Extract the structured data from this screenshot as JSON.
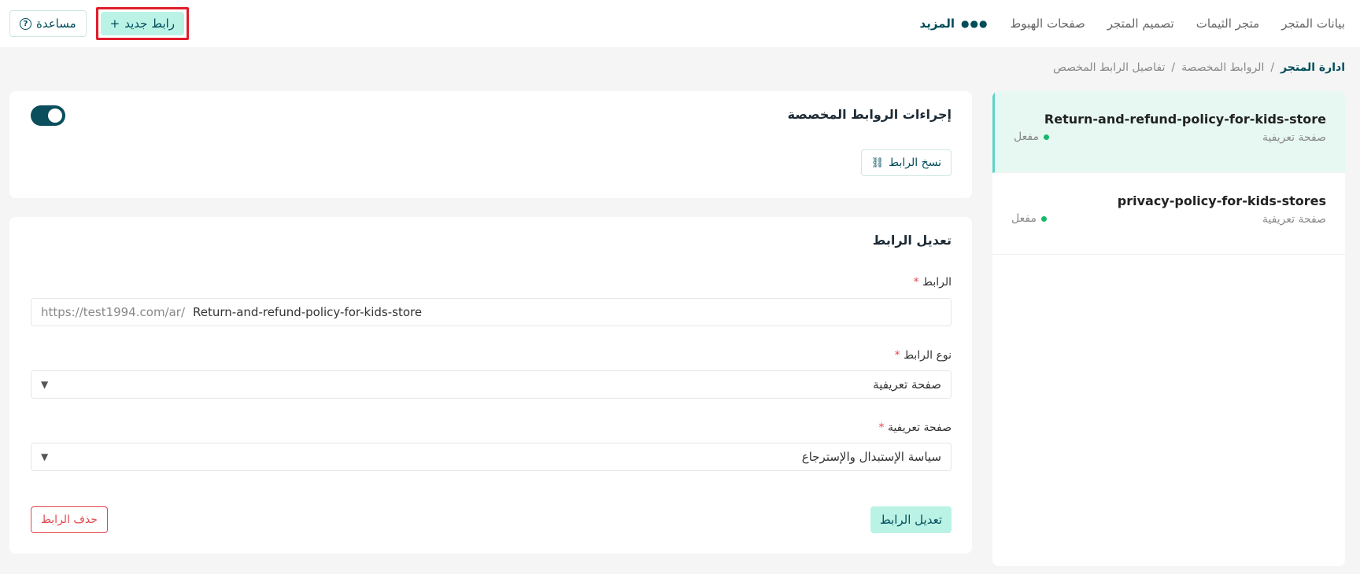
{
  "nav": {
    "items": [
      "بيانات المتجر",
      "متجر الثيمات",
      "تصميم المتجر",
      "صفحات الهبوط"
    ],
    "more_label": "المزيد"
  },
  "toolbar": {
    "new_link_label": "رابط جديد",
    "help_label": "مساعدة"
  },
  "breadcrumb": {
    "root": "ادارة المتجر",
    "middle": "الروابط المخصصة",
    "current": "تفاصيل الرابط المخصص",
    "separator": "/"
  },
  "sidebar": {
    "items": [
      {
        "name": "Return-and-refund-policy-for-kids-store",
        "type": "صفحة تعريفية",
        "status": "مفعل",
        "active": true
      },
      {
        "name": "privacy-policy-for-kids-stores",
        "type": "صفحة تعريفية",
        "status": "مفعل",
        "active": false
      }
    ]
  },
  "actions_card": {
    "title": "إجراءات الروابط المخصصة",
    "copy_label": "نسخ الرابط",
    "enabled": true
  },
  "edit_card": {
    "title": "تعديل الرابط",
    "link_label": "الرابط",
    "link_prefix": "https://test1994.com/ar/",
    "link_value": "Return-and-refund-policy-for-kids-store",
    "type_label": "نوع الرابط",
    "type_value": "صفحة تعريفية",
    "page_label": "صفحة تعريفية",
    "page_value": "سياسة الإستبدال والإسترجاع",
    "required_mark": "*",
    "submit_label": "تعديل الرابط",
    "delete_label": "حذف الرابط"
  },
  "colors": {
    "accent": "#004d5a",
    "accent_light": "#baf3e6",
    "danger": "#e5484d",
    "active_dot": "#18b86b"
  }
}
